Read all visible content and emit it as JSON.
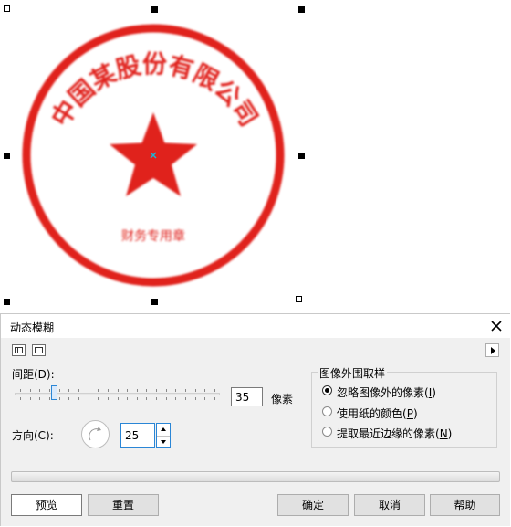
{
  "stamp": {
    "arc_text": "中国某股份有限公司",
    "bottom_text": "财务专用章",
    "color": "#e0231f"
  },
  "dialog": {
    "title": "动态模糊",
    "spacing_label": "间距(D):",
    "spacing_value": "35",
    "spacing_slider": {
      "value": 35,
      "min": 0,
      "max": 200
    },
    "unit": "像素",
    "direction_label": "方向(C):",
    "direction_value": "25",
    "direction_degrees": 25,
    "group_title": "图像外围取样",
    "options": [
      {
        "text": "忽略图像外的像素(",
        "key": "I",
        "end": ")",
        "selected": true
      },
      {
        "text": "使用纸的颜色(",
        "key": "P",
        "end": ")",
        "selected": false
      },
      {
        "text": "提取最近边缘的像素(",
        "key": "N",
        "end": ")",
        "selected": false
      }
    ],
    "buttons": {
      "preview": "预览",
      "reset": "重置",
      "ok": "确定",
      "cancel": "取消",
      "help": "帮助"
    }
  },
  "colors": {
    "accent": "#2a86d6",
    "stamp_red": "#e0231f"
  }
}
